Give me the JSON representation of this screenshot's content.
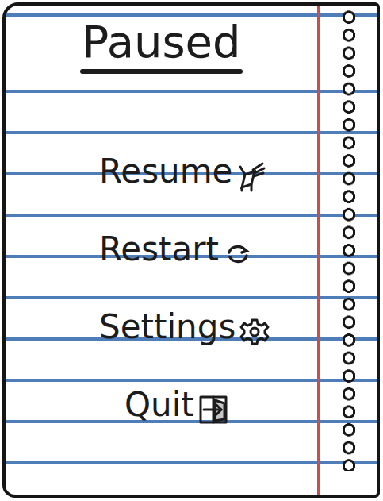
{
  "title": "Paused",
  "menu": [
    {
      "label": "Resume"
    },
    {
      "label": "Restart"
    },
    {
      "label": "Settings"
    },
    {
      "label": "Quit"
    }
  ]
}
